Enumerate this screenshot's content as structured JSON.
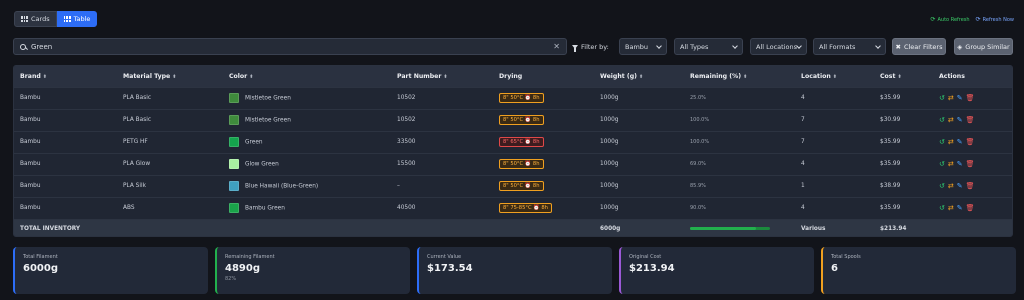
{
  "view_toggle": {
    "cards_label": "Cards",
    "table_label": "Table"
  },
  "top_actions": {
    "auto_refresh": "Auto Refresh",
    "refresh_now": "Refresh Now"
  },
  "search": {
    "value": "Green",
    "placeholder": ""
  },
  "filters": {
    "label": "Filter by:",
    "brand": "Bambu",
    "type": "All Types",
    "location": "All Locations",
    "format": "All Formats",
    "clear": "Clear Filters",
    "group": "Group Similar"
  },
  "table": {
    "headers": [
      "Brand",
      "Material Type",
      "Color",
      "Part Number",
      "Drying",
      "Weight (g)",
      "Remaining (%)",
      "Location",
      "Cost",
      "Actions"
    ],
    "rows": [
      {
        "brand": "Bambu",
        "type": "PLA Basic",
        "color_name": "Mistletoe Green",
        "color": "#3f8b3c",
        "part": "10502",
        "drying": "8\" 50°C ⏰ 8h",
        "drying_hot": false,
        "weight": "1000g",
        "remaining": "25.0%",
        "location": "4",
        "cost": "$35.99"
      },
      {
        "brand": "Bambu",
        "type": "PLA Basic",
        "color_name": "Mistletoe Green",
        "color": "#3f8b3c",
        "part": "10502",
        "drying": "8\" 50°C ⏰ 8h",
        "drying_hot": false,
        "weight": "1000g",
        "remaining": "100.0%",
        "location": "7",
        "cost": "$30.99"
      },
      {
        "brand": "Bambu",
        "type": "PETG HF",
        "color_name": "Green",
        "color": "#14a44d",
        "part": "33500",
        "drying": "8\" 65°C ⏰ 8h",
        "drying_hot": true,
        "weight": "1000g",
        "remaining": "100.0%",
        "location": "7",
        "cost": "$35.99"
      },
      {
        "brand": "Bambu",
        "type": "PLA Glow",
        "color_name": "Glow Green",
        "color": "#a8f0a0",
        "part": "15500",
        "drying": "8\" 50°C ⏰ 8h",
        "drying_hot": false,
        "weight": "1000g",
        "remaining": "69.0%",
        "location": "4",
        "cost": "$35.99"
      },
      {
        "brand": "Bambu",
        "type": "PLA Silk",
        "color_name": "Blue Hawaii (Blue-Green)",
        "color": "#3fa0c0",
        "part": "–",
        "drying": "8\" 50°C ⏰ 8h",
        "drying_hot": false,
        "weight": "1000g",
        "remaining": "85.9%",
        "location": "1",
        "cost": "$38.99"
      },
      {
        "brand": "Bambu",
        "type": "ABS",
        "color_name": "Bambu Green",
        "color": "#1aa34a",
        "part": "40500",
        "drying": "8\" 75-85°C ⏰ 8h",
        "drying_hot": false,
        "weight": "1000g",
        "remaining": "90.0%",
        "location": "4",
        "cost": "$35.99"
      }
    ],
    "total": {
      "label": "TOTAL INVENTORY",
      "weight": "6000g",
      "remaining_fraction": 0.82,
      "location": "Various",
      "cost": "$213.94"
    }
  },
  "stats": [
    {
      "label": "Total Filament",
      "value": "6000g",
      "sub": "",
      "accent": "#2d6df6"
    },
    {
      "label": "Remaining Filament",
      "value": "4890g",
      "sub": "82%",
      "accent": "#22b04d"
    },
    {
      "label": "Current Value",
      "value": "$173.54",
      "sub": "",
      "accent": "#2d6df6"
    },
    {
      "label": "Original Cost",
      "value": "$213.94",
      "sub": "",
      "accent": "#9b59d6"
    },
    {
      "label": "Total Spools",
      "value": "6",
      "sub": "",
      "accent": "#f0a020"
    }
  ]
}
